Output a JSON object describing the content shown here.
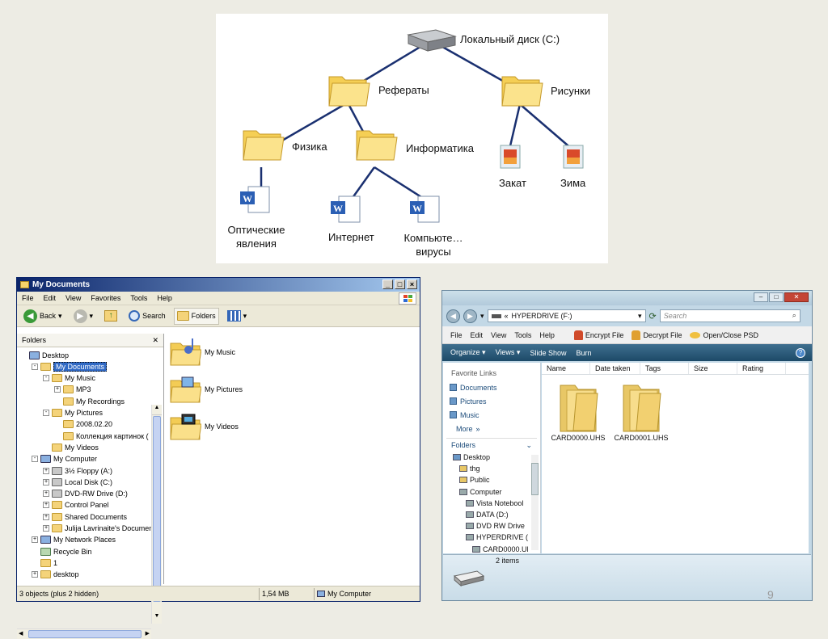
{
  "tree_diagram": {
    "root": "Локальный диск (C:)",
    "folders": [
      "Рефераты",
      "Рисунки",
      "Физика",
      "Информатика"
    ],
    "images": [
      "Закат",
      "Зима"
    ],
    "documents": [
      "Оптические явления",
      "Интернет",
      "Компьюте… вирусы"
    ]
  },
  "xp_window": {
    "title": "My Documents",
    "menu": [
      "File",
      "Edit",
      "View",
      "Favorites",
      "Tools",
      "Help"
    ],
    "toolbar": {
      "back": "Back",
      "search": "Search",
      "folders": "Folders"
    },
    "folders_pane_title": "Folders",
    "tree": [
      {
        "label": "Desktop",
        "indent": 0,
        "expander": "",
        "icon": "desktop-icon"
      },
      {
        "label": "My Documents",
        "indent": 1,
        "expander": "-",
        "icon": "folder-icon",
        "selected": true
      },
      {
        "label": "My Music",
        "indent": 2,
        "expander": "-",
        "icon": "music-folder-icon"
      },
      {
        "label": "MP3",
        "indent": 3,
        "expander": "+",
        "icon": "folder-icon"
      },
      {
        "label": "My Recordings",
        "indent": 3,
        "expander": "",
        "icon": "folder-icon"
      },
      {
        "label": "My Pictures",
        "indent": 2,
        "expander": "-",
        "icon": "pictures-folder-icon"
      },
      {
        "label": "2008.02.20",
        "indent": 3,
        "expander": "",
        "icon": "folder-icon"
      },
      {
        "label": "Коллекция картинок (",
        "indent": 3,
        "expander": "",
        "icon": "folder-icon"
      },
      {
        "label": "My Videos",
        "indent": 2,
        "expander": "",
        "icon": "videos-folder-icon"
      },
      {
        "label": "My Computer",
        "indent": 1,
        "expander": "-",
        "icon": "computer-icon"
      },
      {
        "label": "3½ Floppy (A:)",
        "indent": 2,
        "expander": "+",
        "icon": "floppy-icon"
      },
      {
        "label": "Local Disk (C:)",
        "indent": 2,
        "expander": "+",
        "icon": "disk-icon"
      },
      {
        "label": "DVD-RW Drive (D:)",
        "indent": 2,
        "expander": "+",
        "icon": "dvd-icon"
      },
      {
        "label": "Control Panel",
        "indent": 2,
        "expander": "+",
        "icon": "control-panel-icon"
      },
      {
        "label": "Shared Documents",
        "indent": 2,
        "expander": "+",
        "icon": "folder-icon"
      },
      {
        "label": "Julija Lavrinaite's Document",
        "indent": 2,
        "expander": "+",
        "icon": "folder-icon"
      },
      {
        "label": "My Network Places",
        "indent": 1,
        "expander": "+",
        "icon": "network-icon"
      },
      {
        "label": "Recycle Bin",
        "indent": 1,
        "expander": "",
        "icon": "recycle-bin-icon"
      },
      {
        "label": "1",
        "indent": 1,
        "expander": "",
        "icon": "folder-icon"
      },
      {
        "label": "desktop",
        "indent": 1,
        "expander": "+",
        "icon": "folder-icon"
      }
    ],
    "content_items": [
      "My Music",
      "My Pictures",
      "My Videos"
    ],
    "status": {
      "objects": "3 objects (plus 2 hidden)",
      "size": "1,54 MB",
      "location": "My Computer"
    }
  },
  "vista_window": {
    "address": "HYPERDRIVE (F:)",
    "search_placeholder": "Search",
    "menu": [
      "File",
      "Edit",
      "View",
      "Tools",
      "Help"
    ],
    "menu_actions": [
      "Encrypt File",
      "Decrypt File",
      "Open/Close PSD"
    ],
    "commands": [
      "Organize",
      "Views",
      "Slide Show",
      "Burn"
    ],
    "favorite_links_title": "Favorite Links",
    "favorite_links": [
      "Documents",
      "Pictures",
      "Music"
    ],
    "more": "More",
    "folders_title": "Folders",
    "folder_tree": [
      "Desktop",
      "thg",
      "Public",
      "Computer",
      "Vista Notebool",
      "DATA (D:)",
      "DVD RW Drive",
      "HYPERDRIVE (F",
      "CARD0000.UH"
    ],
    "columns": [
      "Name",
      "Date taken",
      "Tags",
      "Size",
      "Rating"
    ],
    "files": [
      "CARD0000.UHS",
      "CARD0001.UHS"
    ],
    "details": "2 items"
  },
  "page_number": "9"
}
